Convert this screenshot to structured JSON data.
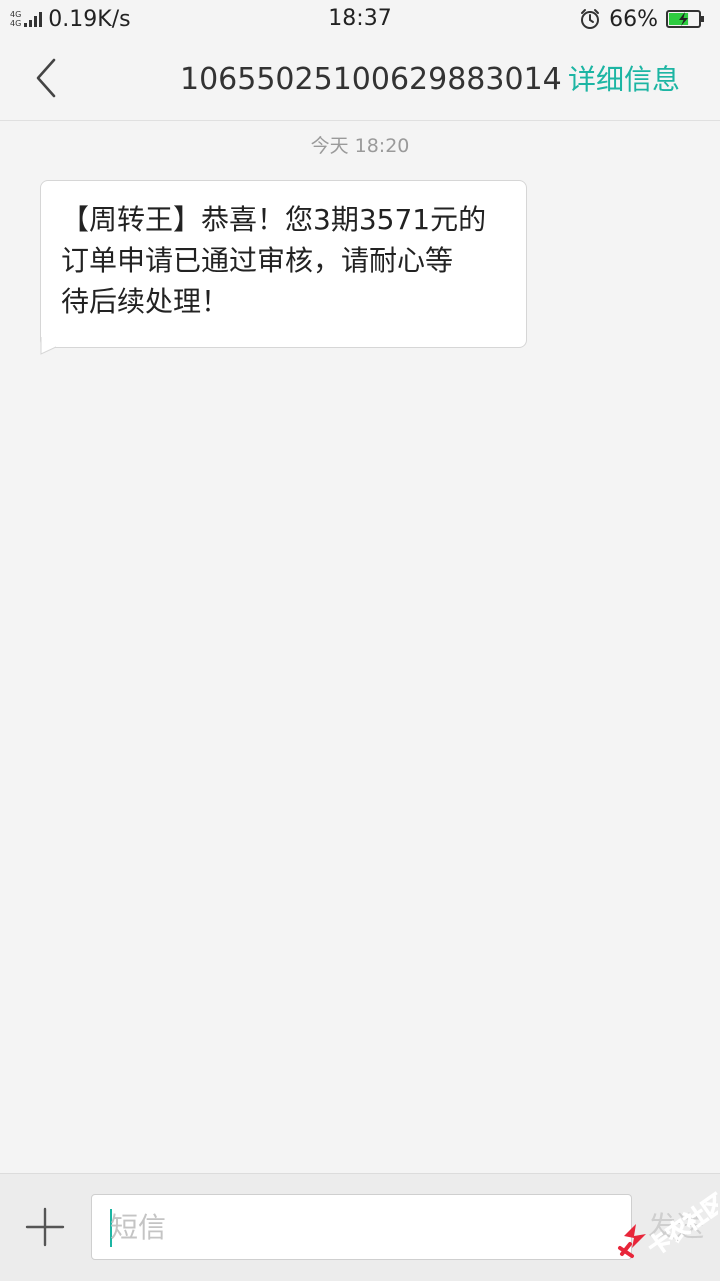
{
  "status_bar": {
    "network_type_1": "4G",
    "network_type_2": "4G",
    "net_speed": "0.19K/s",
    "time": "18:37",
    "alarm_icon": "alarm-clock-icon",
    "battery_percent": "66%",
    "battery_level": 0.66,
    "battery_charging": true
  },
  "header": {
    "back_icon": "chevron-left-icon",
    "contact_number": "10655025100629883014",
    "details_label": "详细信息"
  },
  "conversation": {
    "date_label": "今天 18:20",
    "messages": [
      {
        "direction": "incoming",
        "lines": [
          "【周转王】恭喜！您3期3571元的",
          "订单申请已通过审核，请耐心等",
          "待后续处理！"
        ]
      }
    ]
  },
  "composer": {
    "add_icon": "plus-icon",
    "placeholder": "短信",
    "value": "",
    "send_label": "发送"
  },
  "watermark": {
    "text": "卡农社区"
  },
  "colors": {
    "accent": "#1cb5a3",
    "background": "#f4f4f4",
    "bubble": "#ffffff",
    "battery_fill": "#2ecc40",
    "watermark": "#e8263a"
  }
}
